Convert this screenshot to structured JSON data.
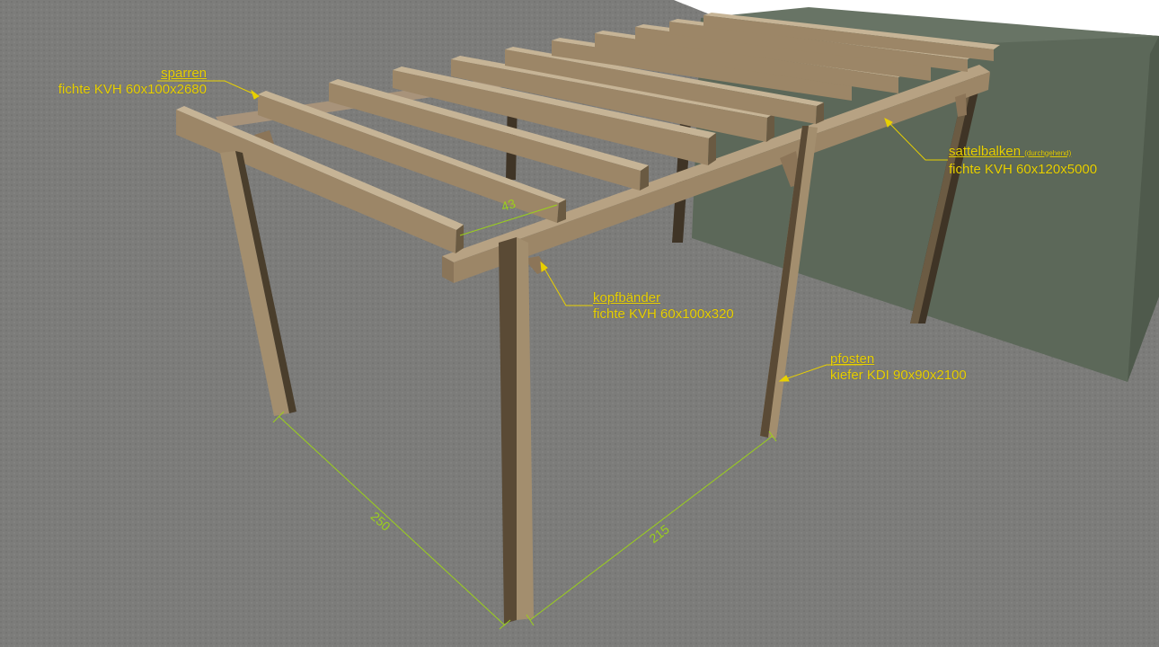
{
  "annotations": {
    "sparren": {
      "title": "sparren",
      "spec": "fichte KVH 60x100x2680"
    },
    "sattelbalken": {
      "title": "sattelbalken",
      "title_note": "(durchgehend)",
      "spec": "fichte KVH 60x120x5000"
    },
    "kopfbaender": {
      "title": "kopfbänder",
      "spec": "fichte KVH 60x100x320"
    },
    "pfosten": {
      "title": "pfosten",
      "spec": "kiefer KDI 90x90x2100"
    }
  },
  "dimensions": {
    "rafter_spacing": "43",
    "depth": "250",
    "width": "215"
  },
  "colors": {
    "label": "#e8d000",
    "dimension": "#9bd11a",
    "wood_light": "#a38e6e",
    "wood_dark": "#4a3e2c",
    "wall": "#5f6a5d",
    "ground": "#7d7d7b",
    "sky": "#ffffff"
  }
}
